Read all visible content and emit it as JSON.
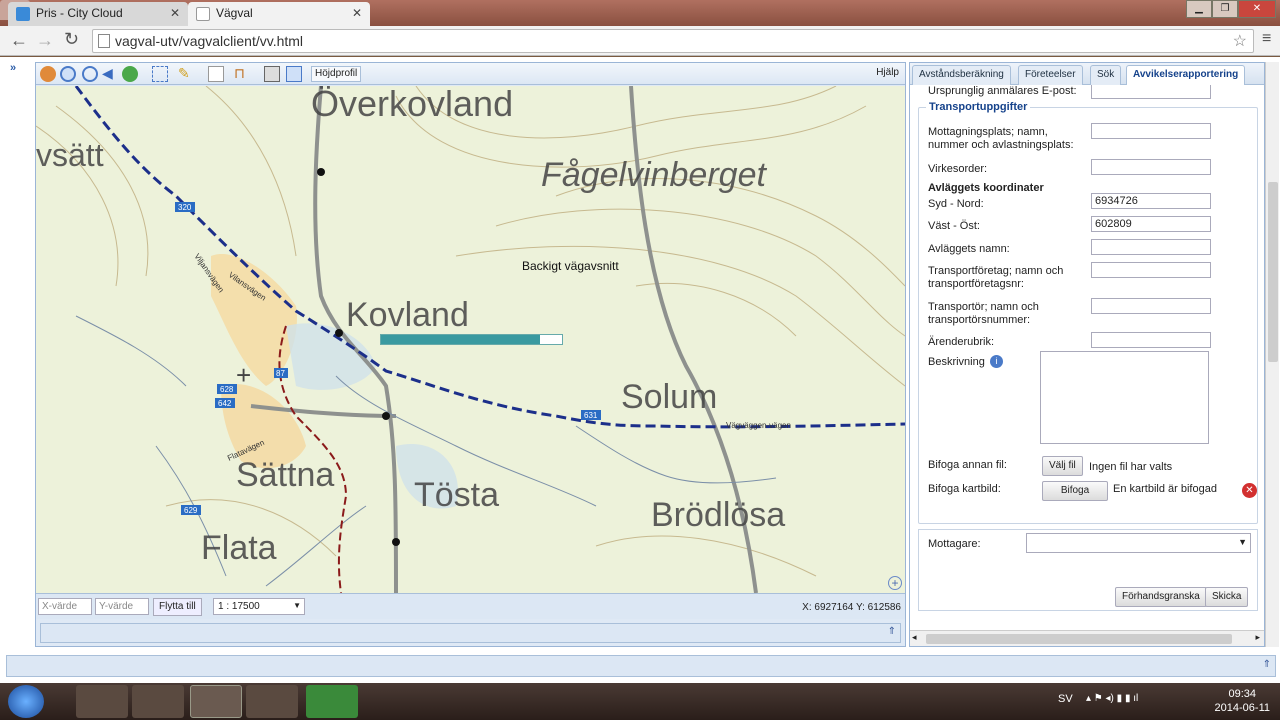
{
  "browser": {
    "tabs": [
      {
        "title": "Pris - City Cloud",
        "active": false
      },
      {
        "title": "Vägval",
        "active": true
      }
    ],
    "url": "vagval-utv/vagvalclient/vv.html"
  },
  "map_toolbar": {
    "hojdprofil": "Höjdprofil",
    "help": "Hjälp"
  },
  "map": {
    "places": [
      "Överkovland",
      "Fågelvinberget",
      "vsätt",
      "Kovland",
      "Solum",
      "Sättna",
      "Tösta",
      "Brödlösa",
      "Flata"
    ],
    "road_labels": [
      "Viljansvägen",
      "Vilansvägen",
      "Flatavägen",
      "Vägväggen-vägen"
    ],
    "road_numbers": [
      "320",
      "628",
      "642",
      "629",
      "631",
      "87"
    ],
    "overlay_text": "Backigt vägavsnitt",
    "progress": 0.88,
    "colors": {
      "route": "#1c2f8a",
      "railway": "#8b1a1a",
      "progress": "#3a9aa0"
    }
  },
  "map_bottom": {
    "x_placeholder": "X-värde",
    "y_placeholder": "Y-värde",
    "flytta_label": "Flytta till",
    "scale": "1 : 17500",
    "coord_x": "X: 6927164",
    "coord_y": "Y: 612586"
  },
  "panel": {
    "tabs": [
      "Avståndsberäkning",
      "Företeelser",
      "Sök",
      "Avvikelserapportering"
    ],
    "active_tab": "Avvikelserapportering",
    "top_label": "Ursprunglig anmälares E-post:",
    "section_title": "Transportuppgifter",
    "fields": {
      "mottagningsplats": "Mottagningsplats; namn, nummer och avlastningsplats:",
      "virkesorder": "Virkesorder:",
      "coords_title": "Avläggets koordinater",
      "syd_nord": "Syd - Nord:",
      "syd_nord_value": "6934726",
      "vast_ost": "Väst - Öst:",
      "vast_ost_value": "602809",
      "avlagg_namn": "Avläggets namn:",
      "transportforetag": "Transportföretag; namn och transportföretagsnr:",
      "transportor": "Transportör; namn och transportörsnummer:",
      "arenderubrik": "Ärenderubrik:",
      "beskrivning": "Beskrivning"
    },
    "file": {
      "label": "Bifoga annan fil:",
      "button": "Välj fil",
      "status": "Ingen fil har valts"
    },
    "kartbild": {
      "label": "Bifoga kartbild:",
      "button": "Bifoga",
      "status": "En kartbild är bifogad"
    },
    "mottagare_label": "Mottagare:",
    "preview_button": "Förhandsgranska",
    "send_button": "Skicka"
  },
  "taskbar": {
    "lang": "SV",
    "time": "09:34",
    "date": "2014-06-11"
  }
}
